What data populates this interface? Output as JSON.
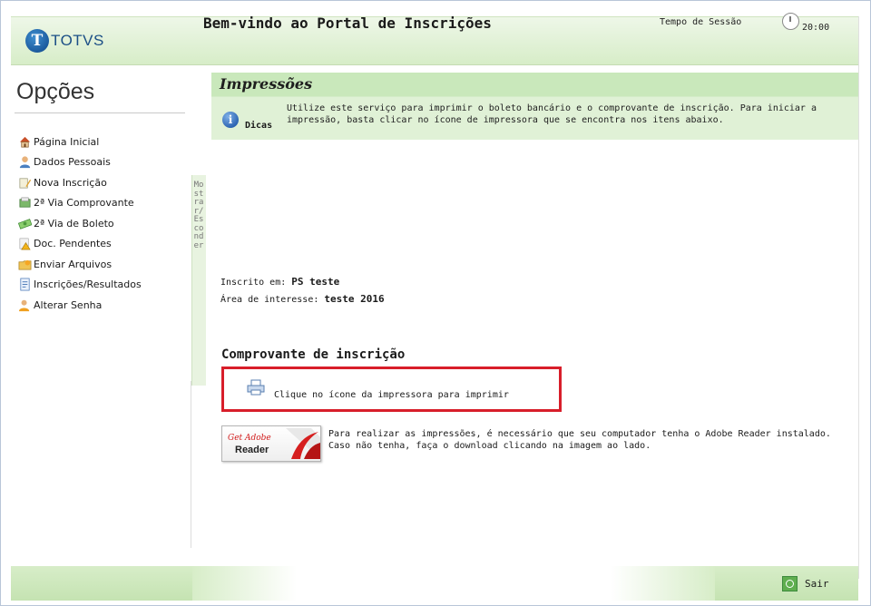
{
  "header": {
    "logo_text": "TOTVS",
    "logo_letter": "T",
    "welcome": "Bem-vindo ao Portal de Inscrições",
    "session_label": "Tempo de Sessão",
    "session_time": "20:00"
  },
  "sidebar": {
    "title": "Opções",
    "items": [
      {
        "label": "Página Inicial",
        "icon": "home-icon"
      },
      {
        "label": "Dados Pessoais",
        "icon": "user-icon"
      },
      {
        "label": "Nova Inscrição",
        "icon": "edit-icon"
      },
      {
        "label": "2ª Via Comprovante",
        "icon": "receipt-icon"
      },
      {
        "label": "2ª Via de Boleto",
        "icon": "money-icon"
      },
      {
        "label": "Doc. Pendentes",
        "icon": "warning-icon"
      },
      {
        "label": "Enviar Arquivos",
        "icon": "folder-icon"
      },
      {
        "label": "Inscrições/Resultados",
        "icon": "document-icon"
      },
      {
        "label": "Alterar Senha",
        "icon": "key-user-icon"
      }
    ],
    "toggle_label": "Mostrar/Esconder"
  },
  "main": {
    "section_title": "Impressões",
    "tips_label": "Dicas",
    "tips_text": "Utilize este serviço para imprimir o boleto bancário e o comprovante de inscrição. Para iniciar a impressão, basta clicar no ícone de impressora que se encontra nos itens abaixo.",
    "inscrito_label": "Inscrito em:",
    "inscrito_value": "PS teste",
    "area_label": "Área de interesse:",
    "area_value": "teste 2016",
    "comprovante_title": "Comprovante de inscrição",
    "print_text": "Clique no ícone da impressora para imprimir",
    "adobe_get": "Get Adobe",
    "adobe_reader": "Reader",
    "adobe_text": "Para realizar as impressões, é necessário que seu computador tenha o Adobe Reader instalado. Caso não tenha, faça o download clicando na imagem ao lado."
  },
  "footer": {
    "logout_label": "Sair"
  },
  "colors": {
    "header_green": "#d7edc8",
    "title_bar_green": "#c9e8bb",
    "highlight_red": "#d81e2a",
    "brand_blue": "#1b4f86"
  }
}
